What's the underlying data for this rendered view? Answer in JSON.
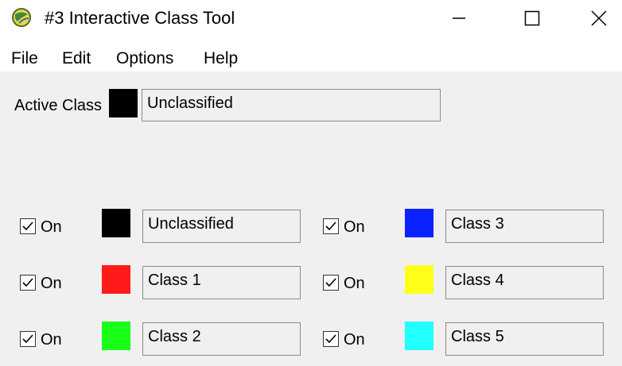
{
  "window": {
    "title": "#3 Interactive Class Tool",
    "app_icon": "globe-icon",
    "controls": [
      "minimize-icon",
      "maximize-icon",
      "close-icon"
    ]
  },
  "menu": [
    "File",
    "Edit",
    "Options",
    "Help"
  ],
  "active_class": {
    "label": "Active Class",
    "color": "#000000",
    "value": "Unclassified"
  },
  "classes": [
    {
      "checkbox_label": "On",
      "checked": true,
      "color": "#000000",
      "name": "Unclassified"
    },
    {
      "checkbox_label": "On",
      "checked": true,
      "color": "#ff1a1a",
      "name": "Class 1"
    },
    {
      "checkbox_label": "On",
      "checked": true,
      "color": "#1aff1a",
      "name": "Class 2"
    },
    {
      "checkbox_label": "On",
      "checked": true,
      "color": "#0a22ff",
      "name": "Class 3"
    },
    {
      "checkbox_label": "On",
      "checked": true,
      "color": "#ffff1a",
      "name": "Class 4"
    },
    {
      "checkbox_label": "On",
      "checked": true,
      "color": "#22ffff",
      "name": "Class 5"
    }
  ]
}
